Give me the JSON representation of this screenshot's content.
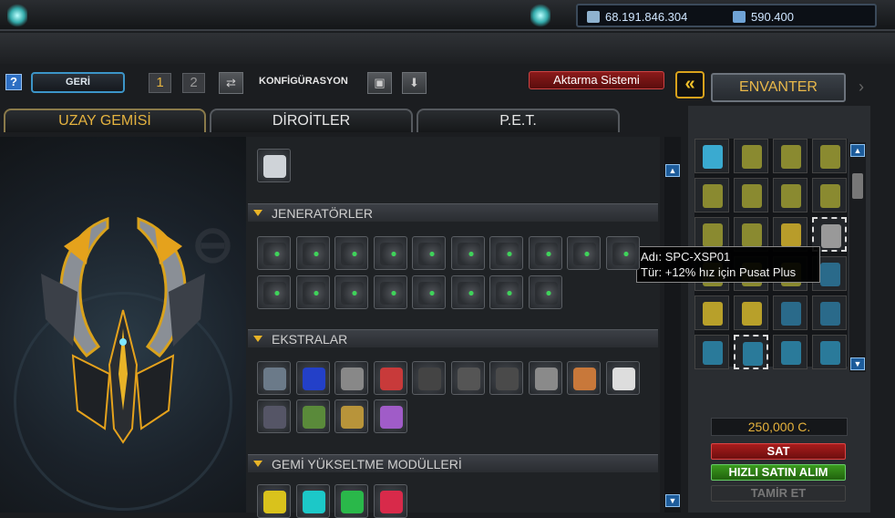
{
  "header": {
    "currency_1": "68.191.846.304",
    "currency_2": "590.400",
    "currency_1_icon": "credits-icon",
    "currency_2_icon": "uridium-icon"
  },
  "toolbar": {
    "help_label": "?",
    "back_label": "GERİ",
    "config_1": "1",
    "config_2": "2",
    "config_label": "KONFİGÜRASYON",
    "aktarma_label": "Aktarma Sistemi",
    "collapse_label": "«",
    "inventory_label": "ENVANTER",
    "next_label": "›"
  },
  "tabs": [
    {
      "label": "UZAY GEMİSİ"
    },
    {
      "label": "DİROİTLER"
    },
    {
      "label": "P.E.T."
    }
  ],
  "sections": {
    "generators": "JENERATÖRLER",
    "extras": "EKSTRALAR",
    "ship_modules": "GEMİ YÜKSELTME MODÜLLERİ"
  },
  "tooltip": {
    "line1": "Adı: SPC-XSP01",
    "line2": "Tür: +12% hız için Pusat Plus"
  },
  "shop": {
    "price": "250,000 C.",
    "sell": "SAT",
    "quick_buy": "HIZLI SATIN ALIM",
    "repair": "TAMİR ET"
  },
  "colors": {
    "accent": "#e5b33f",
    "sell": "#a81c1c",
    "buy": "#3b9a1e",
    "link_blue": "#3c95c8"
  }
}
